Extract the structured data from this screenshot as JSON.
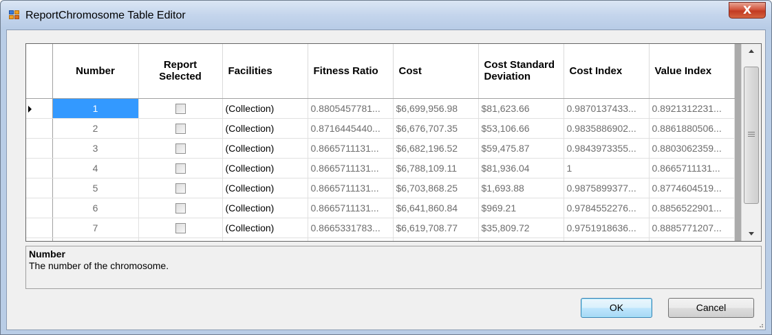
{
  "window": {
    "title": "ReportChromosome Table Editor",
    "close_label": "X"
  },
  "grid": {
    "columns": [
      "Number",
      "Report Selected",
      "Facilities",
      "Fitness Ratio",
      "Cost",
      "Cost Standard Deviation",
      "Cost Index",
      "Value Index"
    ],
    "selected_row": 0,
    "rows": [
      {
        "number": "1",
        "report_selected": false,
        "facilities": "(Collection)",
        "fitness_ratio": "0.8805457781...",
        "cost": "$6,699,956.98",
        "cost_std_dev": "$81,623.66",
        "cost_index": "0.9870137433...",
        "value_index": "0.8921312231..."
      },
      {
        "number": "2",
        "report_selected": false,
        "facilities": "(Collection)",
        "fitness_ratio": "0.8716445440...",
        "cost": "$6,676,707.35",
        "cost_std_dev": "$53,106.66",
        "cost_index": "0.9835886902...",
        "value_index": "0.8861880506..."
      },
      {
        "number": "3",
        "report_selected": false,
        "facilities": "(Collection)",
        "fitness_ratio": "0.8665711131...",
        "cost": "$6,682,196.52",
        "cost_std_dev": "$59,475.87",
        "cost_index": "0.9843973355...",
        "value_index": "0.8803062359..."
      },
      {
        "number": "4",
        "report_selected": false,
        "facilities": "(Collection)",
        "fitness_ratio": "0.8665711131...",
        "cost": "$6,788,109.11",
        "cost_std_dev": "$81,936.04",
        "cost_index": "1",
        "value_index": "0.8665711131..."
      },
      {
        "number": "5",
        "report_selected": false,
        "facilities": "(Collection)",
        "fitness_ratio": "0.8665711131...",
        "cost": "$6,703,868.25",
        "cost_std_dev": "$1,693.88",
        "cost_index": "0.9875899377...",
        "value_index": "0.8774604519..."
      },
      {
        "number": "6",
        "report_selected": false,
        "facilities": "(Collection)",
        "fitness_ratio": "0.8665711131...",
        "cost": "$6,641,860.84",
        "cost_std_dev": "$969.21",
        "cost_index": "0.9784552276...",
        "value_index": "0.8856522901..."
      },
      {
        "number": "7",
        "report_selected": false,
        "facilities": "(Collection)",
        "fitness_ratio": "0.8665331783...",
        "cost": "$6,619,708.77",
        "cost_std_dev": "$35,809.72",
        "cost_index": "0.9751918636...",
        "value_index": "0.8885771207..."
      }
    ]
  },
  "help": {
    "title": "Number",
    "description": "The number of the chromosome."
  },
  "buttons": {
    "ok": "OK",
    "cancel": "Cancel"
  },
  "colors": {
    "selection": "#3399ff",
    "close_button": "#c23a22",
    "title_bar": "#c4d5ec"
  }
}
